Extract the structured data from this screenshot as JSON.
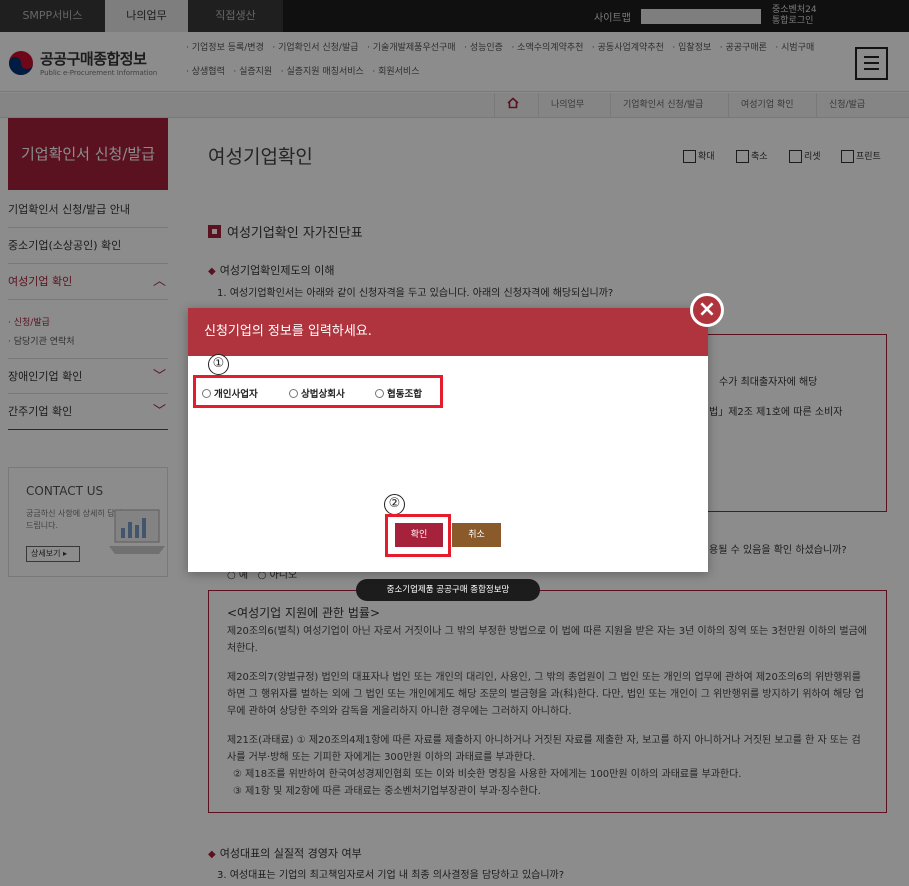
{
  "topbar": {
    "tabs": [
      "SMPP서비스",
      "나의업무",
      "직접생산"
    ],
    "sitemap": "사이트맵",
    "right_links": [
      "중소벤처24",
      "통합로그인"
    ]
  },
  "header": {
    "logo_title": "공공구매종합정보",
    "logo_sub": "Public e-Procurement Information",
    "gnb": [
      "기업정보 등록/변경",
      "기업확인서 신청/발급",
      "기술개발제품우선구매",
      "성능인증",
      "소액수의계약추천",
      "공동사업계약추천",
      "입찰정보",
      "공공구매론",
      "시범구매",
      "상생협력",
      "실증지원",
      "실증지원 매칭서비스",
      "회원서비스"
    ]
  },
  "breadcrumb": [
    "나의업무",
    "기업확인서 신청/발급",
    "여성기업 확인",
    "신청/발급"
  ],
  "lnb": {
    "title": "기업확인서 신청/발급",
    "items": [
      "기업확인서 신청/발급 안내",
      "중소기업(소상공인) 확인",
      "여성기업 확인",
      "장애인기업 확인",
      "간주기업 확인"
    ],
    "subs": [
      "신청/발급",
      "담당기관 연락처"
    ],
    "contact": {
      "title": "CONTACT US",
      "desc": "궁금하신 사항에 상세히 답변 드립니다.",
      "button": "상세보기"
    }
  },
  "main": {
    "title": "여성기업확인",
    "tools": [
      "확대",
      "축소",
      "리셋",
      "프린트"
    ],
    "section_title": "여성기업확인 자가진단표",
    "q1_head": "여성기업확인제도의 이해",
    "q1_text": "1. 여성기업확인서는 아래와 같이 신청자격을 두고 있습니다. 아래의 신청자격에 해당되십니까?",
    "box_frag1": "수가 최대출자자에 해당",
    "box_frag2": "법」제2조 제1호에 따른 소비자",
    "q2_frag": "용될 수 있음을 확인 하셨습니까?",
    "radio_frag": [
      "예",
      "아니오"
    ],
    "law_title": "<여성기업 지원에 관한 법률>",
    "law_p1": "제20조의6(벌칙) 여성기업이 아닌 자로서 거짓이나 그 밖의 부정한 방법으로 이 법에 따른 지원을 받은 자는 3년 이하의 징역 또는 3천만원 이하의 벌금에 처한다.",
    "law_p2": "제20조의7(양벌규정) 법인의 대표자나 법인 또는 개인의 대리인, 사용인, 그 밖의 종업원이 그 법인 또는 개인의 업무에 관하여 제20조의6의 위반행위를 하면 그 행위자를 벌하는 외에 그 법인 또는 개인에게도 해당 조문의 벌금형을 과(科)한다. 다만, 법인 또는 개인이 그 위반행위를 방지하기 위하여 해당 업무에 관하여 상당한 주의와 감독을 게을리하지 아니한 경우에는 그러하지 아니하다.",
    "law_p3": "제21조(과태료) ① 제20조의4제1항에 따른 자료를 제출하지 아니하거나 거짓된 자료를 제출한 자, 보고를 하지 아니하거나 거짓된 보고를 한 자 또는 검사를 거부·방해 또는 기피한 자에게는 300만원 이하의 과태료를 부과한다.",
    "law_p4": "② 제18조를 위반하여 한국여성경제인협회 또는 이와 비슷한 명칭을 사용한 자에게는 100만원 이하의 과태료를 부과한다.",
    "law_p5": "③ 제1항 및 제2항에 따른 과태료는 중소벤처기업부장관이 부과·징수한다.",
    "q3_head": "여성대표의 실질적 경영자 여부",
    "q3_text": "3. 여성대표는 기업의 최고책임자로서 기업 내 최종 의사결정을 담당하고 있습니까?"
  },
  "tooltip": "중소기업제품 공공구매 종합정보망",
  "modal": {
    "title": "신청기업의 정보를 입력하세요.",
    "options": [
      "개인사업자",
      "상법상회사",
      "협동조합"
    ],
    "callout1": "①",
    "callout2": "②",
    "confirm": "확인",
    "cancel": "취소",
    "close": "×"
  }
}
